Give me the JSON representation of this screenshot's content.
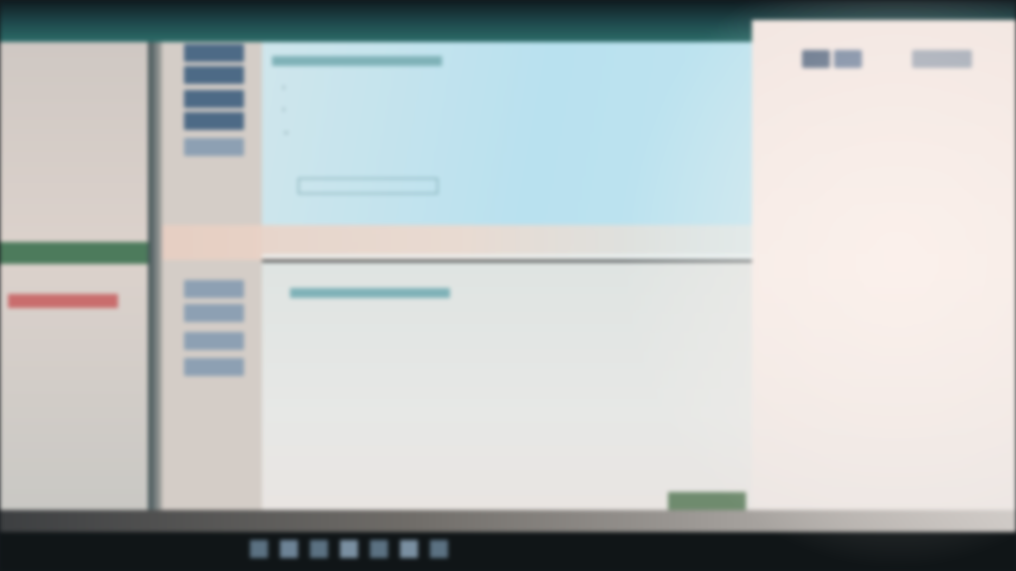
{
  "window": {
    "title": ""
  },
  "left_nav": {
    "items": [
      {
        "label": ""
      },
      {
        "label": ""
      },
      {
        "label": ""
      },
      {
        "label": ""
      },
      {
        "label": ""
      },
      {
        "label": ""
      },
      {
        "label": ""
      },
      {
        "label": ""
      },
      {
        "label": ""
      },
      {
        "label": ""
      }
    ]
  },
  "content": {
    "tree_items": [
      {
        "label": ""
      },
      {
        "label": ""
      },
      {
        "label": ""
      },
      {
        "label": ""
      },
      {
        "label": ""
      },
      {
        "label": ""
      },
      {
        "label": ""
      },
      {
        "label": ""
      },
      {
        "label": ""
      },
      {
        "label": ""
      },
      {
        "label": ""
      },
      {
        "label": ""
      },
      {
        "label": ""
      }
    ]
  },
  "right_panel": {
    "labels": [
      {
        "label": ""
      },
      {
        "label": ""
      }
    ]
  },
  "dialog": {
    "ok_label": ""
  },
  "colors": {
    "titlebar": "#2c6b68",
    "nav_selected": "#4d7b5c",
    "nav_alert": "#c96d6d",
    "content_bg": "#b9e1ef",
    "button": "#6f8b6e"
  }
}
